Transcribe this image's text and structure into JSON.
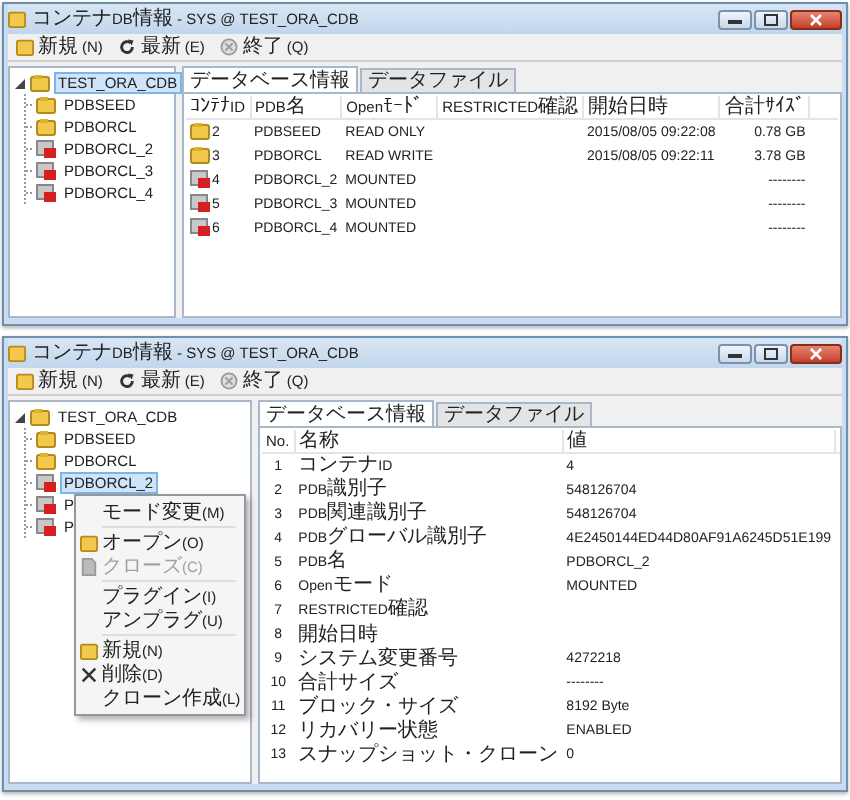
{
  "windows": [
    {
      "title": "コンテナDB情報 - SYS @ TEST_ORA_CDB",
      "toolbar": [
        {
          "label": "新規(N)",
          "kind": "new"
        },
        {
          "label": "最新(E)",
          "kind": "refresh"
        },
        {
          "label": "終了(Q)",
          "kind": "exit"
        }
      ],
      "tree": {
        "label": "TEST_ORA_CDB",
        "expanded": true,
        "selected": true,
        "children": [
          {
            "label": "PDBSEED",
            "kind": "open",
            "selected": false
          },
          {
            "label": "PDBORCL",
            "kind": "open",
            "selected": false
          },
          {
            "label": "PDBORCL_2",
            "kind": "mounted",
            "selected": false
          },
          {
            "label": "PDBORCL_3",
            "kind": "mounted",
            "selected": false
          },
          {
            "label": "PDBORCL_4",
            "kind": "mounted",
            "selected": false
          }
        ]
      },
      "tabs": [
        {
          "label": "データベース情報",
          "selected": true
        },
        {
          "label": "データファイル",
          "selected": false
        }
      ],
      "table": {
        "kind": "pdb_list",
        "columns": [
          "ｺﾝﾃﾅID",
          "PDB名",
          "Openﾓｰﾄﾞ",
          "RESTRICTED確認",
          "開始日時",
          "合計ｻｲｽﾞ"
        ],
        "rows": [
          {
            "kind": "open",
            "cells": [
              "2",
              "PDBSEED",
              "READ ONLY",
              null,
              "2015/08/05 09:22:08",
              "0.78 GB"
            ]
          },
          {
            "kind": "open",
            "cells": [
              "3",
              "PDBORCL",
              "READ WRITE",
              null,
              "2015/08/05 09:22:11",
              "3.78 GB"
            ]
          },
          {
            "kind": "mounted",
            "cells": [
              "4",
              "PDBORCL_2",
              "MOUNTED",
              null,
              null,
              "--------"
            ]
          },
          {
            "kind": "mounted",
            "cells": [
              "5",
              "PDBORCL_3",
              "MOUNTED",
              null,
              null,
              "--------"
            ]
          },
          {
            "kind": "mounted",
            "cells": [
              "6",
              "PDBORCL_4",
              "MOUNTED",
              null,
              null,
              "--------"
            ]
          }
        ]
      }
    },
    {
      "title": "コンテナDB情報 - SYS @ TEST_ORA_CDB",
      "toolbar": [
        {
          "label": "新規(N)",
          "kind": "new"
        },
        {
          "label": "最新(E)",
          "kind": "refresh"
        },
        {
          "label": "終了(Q)",
          "kind": "exit"
        }
      ],
      "tree": {
        "label": "TEST_ORA_CDB",
        "expanded": true,
        "selected": false,
        "children": [
          {
            "label": "PDBSEED",
            "kind": "open",
            "selected": false
          },
          {
            "label": "PDBORCL",
            "kind": "open",
            "selected": false
          },
          {
            "label": "PDBORCL_2",
            "kind": "mounted",
            "selected": true
          },
          {
            "label": "P",
            "kind": "mounted",
            "selected": false
          },
          {
            "label": "P",
            "kind": "mounted",
            "selected": false
          }
        ]
      },
      "tabs": [
        {
          "label": "データベース情報",
          "selected": true
        },
        {
          "label": "データファイル",
          "selected": false
        }
      ],
      "table": {
        "kind": "properties",
        "columns": [
          "No.",
          "名称",
          "値"
        ],
        "rows": [
          {
            "cells": [
              "1",
              "コンテナID",
              "4"
            ]
          },
          {
            "cells": [
              "2",
              "PDB識別子",
              "548126704"
            ]
          },
          {
            "cells": [
              "3",
              "PDB関連識別子",
              "548126704"
            ]
          },
          {
            "cells": [
              "4",
              "PDBグローバル識別子",
              "4E2450144ED44D80AF91A6245D51E199"
            ]
          },
          {
            "cells": [
              "5",
              "PDB名",
              "PDBORCL_2"
            ]
          },
          {
            "cells": [
              "6",
              "Openモード",
              "MOUNTED"
            ]
          },
          {
            "cells": [
              "7",
              "RESTRICTED確認",
              null
            ]
          },
          {
            "cells": [
              "8",
              "開始日時",
              null
            ]
          },
          {
            "cells": [
              "9",
              "システム変更番号",
              "4272218"
            ]
          },
          {
            "cells": [
              "10",
              "合計サイズ",
              "--------"
            ]
          },
          {
            "cells": [
              "11",
              "ブロック・サイズ",
              "8192 Byte"
            ]
          },
          {
            "cells": [
              "12",
              "リカバリー状態",
              "ENABLED"
            ]
          },
          {
            "cells": [
              "13",
              "スナップショット・クローン",
              "0"
            ]
          }
        ]
      },
      "context_menu": {
        "groups": [
          [
            {
              "label": "モード変更(M)",
              "kind": "plain",
              "disabled": false
            }
          ],
          [
            {
              "label": "オープン(O)",
              "kind": "open",
              "disabled": false
            },
            {
              "label": "クローズ(C)",
              "kind": "close",
              "disabled": true
            }
          ],
          [
            {
              "label": "プラグイン(I)",
              "kind": "plain",
              "disabled": false
            },
            {
              "label": "アンプラグ(U)",
              "kind": "plain",
              "disabled": false
            }
          ],
          [
            {
              "label": "新規(N)",
              "kind": "new",
              "disabled": false
            },
            {
              "label": "削除(D)",
              "kind": "delete",
              "disabled": false
            },
            {
              "label": "クローン作成(L)",
              "kind": "plain",
              "disabled": false
            }
          ]
        ]
      }
    }
  ]
}
